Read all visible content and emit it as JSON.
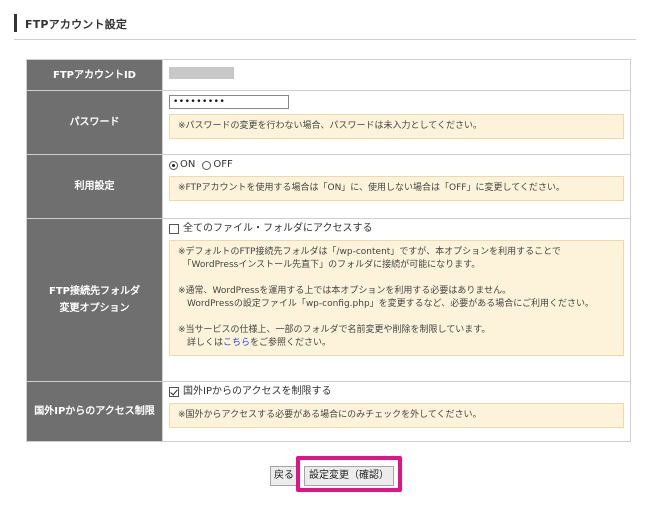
{
  "section": {
    "title": "FTPアカウント設定"
  },
  "rows": {
    "account_id": {
      "label": "FTPアカウントID"
    },
    "password": {
      "label": "パスワード",
      "value": "•••••••••",
      "note": "※パスワードの変更を行わない場合、パスワードは未入力としてください。"
    },
    "usage": {
      "label": "利用設定",
      "on_label": "ON",
      "off_label": "OFF",
      "selected": "ON",
      "note": "※FTPアカウントを使用する場合は「ON」に、使用しない場合は「OFF」に変更してください。"
    },
    "folder": {
      "label_line1": "FTP接続先フォルダ",
      "label_line2": "変更オプション",
      "checkbox_label": "全てのファイル・フォルダにアクセスする",
      "checked": false,
      "note_p1": "※デフォルトのFTP接続先フォルダは「/wp-content」ですが、本オプションを利用することで\n　「WordPressインストール先直下」のフォルダに接続が可能になります。",
      "note_p2": "※通常、WordPressを運用する上では本オプションを利用する必要はありません。\n　WordPressの設定ファイル「wp-config.php」を変更するなど、必要がある場合にご利用ください。",
      "note_p3_line1": "※当サービスの仕様上、一部のフォルダで名前変更や削除を制限しています。",
      "note_p3_pre": "　詳しくは",
      "note_p3_link": "こちら",
      "note_p3_post": "をご参照ください。"
    },
    "foreign_ip": {
      "label": "国外IPからのアクセス制限",
      "checkbox_label": "国外IPからのアクセスを制限する",
      "checked": true,
      "note": "※国外からアクセスする必要がある場合にのみチェックを外してください。"
    }
  },
  "buttons": {
    "back": "戻る",
    "submit": "設定変更（確認）"
  },
  "colors": {
    "header_bg": "#6f6f6f",
    "note_bg": "#fdf3da",
    "highlight": "#e0138a",
    "link": "#1a4fd6"
  }
}
